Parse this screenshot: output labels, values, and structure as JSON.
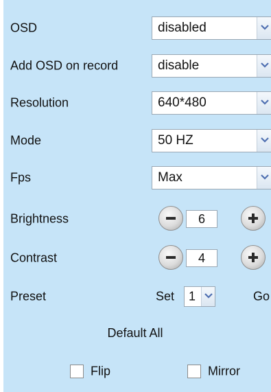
{
  "settings": {
    "osd": {
      "label": "OSD",
      "value": "disabled"
    },
    "add_osd_on_record": {
      "label": "Add OSD on record",
      "value": "disable"
    },
    "resolution": {
      "label": "Resolution",
      "value": "640*480"
    },
    "mode": {
      "label": "Mode",
      "value": "50 HZ"
    },
    "fps": {
      "label": "Fps",
      "value": "Max"
    },
    "brightness": {
      "label": "Brightness",
      "value": "6"
    },
    "contrast": {
      "label": "Contrast",
      "value": "4"
    },
    "preset": {
      "label": "Preset",
      "set_label": "Set",
      "selected": "1",
      "go_label": "Go"
    }
  },
  "actions": {
    "default_all_label": "Default All"
  },
  "toggles": {
    "flip": {
      "label": "Flip",
      "checked": false
    },
    "mirror": {
      "label": "Mirror",
      "checked": false
    }
  },
  "icons": {
    "dropdown": "chevron-down-icon",
    "minus": "minus-icon",
    "plus": "plus-icon"
  },
  "colors": {
    "panel_background": "#c6e4f8",
    "dropdown_arrow": "#4f6fb1"
  }
}
